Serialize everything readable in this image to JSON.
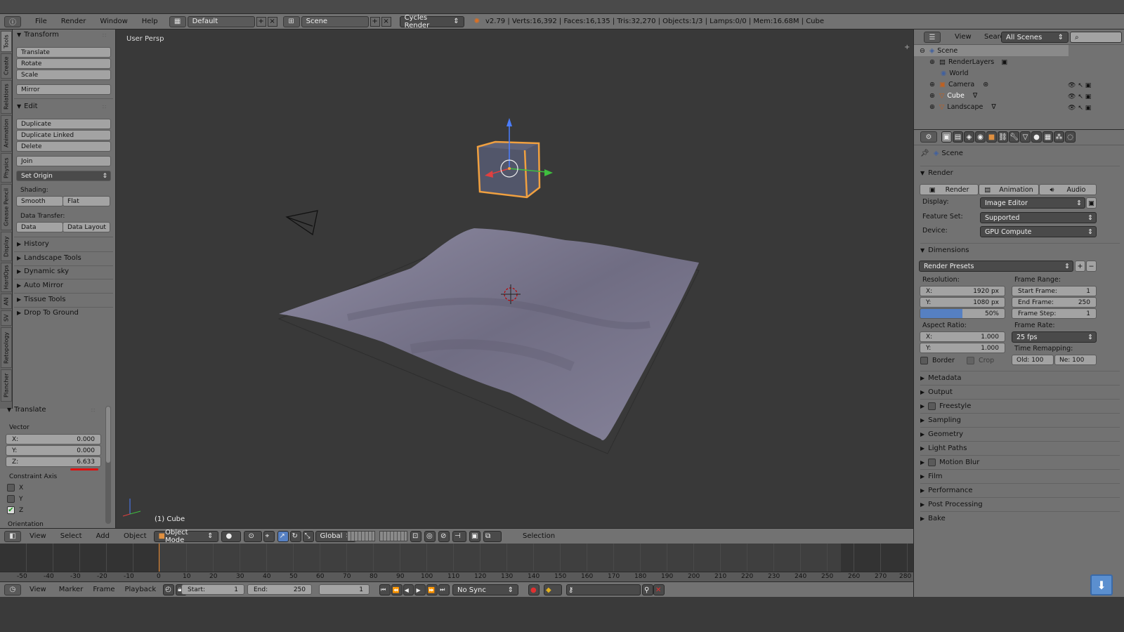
{
  "menubar": {
    "items": [
      "File",
      "Render",
      "Window",
      "Help"
    ],
    "layout": "Default",
    "scene": "Scene",
    "engine": "Cycles Render",
    "status": "v2.79 | Verts:16,392 | Faces:16,135 | Tris:32,270 | Objects:1/3 | Lamps:0/0 | Mem:16.68M | Cube"
  },
  "left_tabs": [
    "Tools",
    "Create",
    "Relations",
    "Animation",
    "Physics",
    "Grease Pencil",
    "Display",
    "HardOps",
    "AN",
    "SV",
    "Retopology",
    "Plancher"
  ],
  "tools": {
    "transform_header": "Transform",
    "transform_buttons": [
      "Translate",
      "Rotate",
      "Scale"
    ],
    "mirror": "Mirror",
    "edit_header": "Edit",
    "edit_buttons": [
      "Duplicate",
      "Duplicate Linked",
      "Delete"
    ],
    "join": "Join",
    "set_origin": "Set Origin",
    "shading_label": "Shading:",
    "smooth": "Smooth",
    "flat": "Flat",
    "data_transfer_label": "Data Transfer:",
    "data": "Data",
    "data_layout": "Data Layout",
    "collapsed": [
      "History",
      "Landscape Tools",
      "Dynamic sky",
      "Auto Mirror",
      "Tissue Tools",
      "Drop To Ground"
    ]
  },
  "operator": {
    "header": "Translate",
    "vector_label": "Vector",
    "x_label": "X:",
    "x": "0.000",
    "y_label": "Y:",
    "y": "0.000",
    "z_label": "Z:",
    "z": "6.633",
    "constraint_label": "Constraint Axis",
    "axes": [
      "X",
      "Y",
      "Z"
    ],
    "axis_checked": [
      false,
      false,
      true
    ],
    "orientation_label": "Orientation"
  },
  "viewport": {
    "persp_label": "User Persp",
    "object_label": "(1) Cube",
    "accent": "#f0a040"
  },
  "viewbar": {
    "view": "View",
    "select": "Select",
    "add": "Add",
    "object": "Object",
    "mode": "Object Mode",
    "orientation": "Global",
    "selection": "Selection"
  },
  "timeline": {
    "ticks": [
      "-50",
      "-40",
      "-30",
      "-20",
      "-10",
      "0",
      "10",
      "20",
      "30",
      "40",
      "50",
      "60",
      "70",
      "80",
      "90",
      "100",
      "110",
      "120",
      "130",
      "140",
      "150",
      "160",
      "170",
      "180",
      "190",
      "200",
      "210",
      "220",
      "230",
      "240",
      "250",
      "260",
      "270",
      "280"
    ],
    "menu": [
      "View",
      "Marker",
      "Frame",
      "Playback"
    ],
    "start_label": "Start:",
    "start": "1",
    "end_label": "End:",
    "end": "250",
    "current": "1",
    "sync": "No Sync"
  },
  "outliner": {
    "view": "View",
    "search": "Search",
    "scenes": "All Scenes",
    "items": [
      "Scene",
      "RenderLayers",
      "World",
      "Camera",
      "Cube",
      "Landscape"
    ]
  },
  "properties": {
    "context": "Scene",
    "render_header": "Render",
    "render_btn": "Render",
    "animation_btn": "Animation",
    "audio_btn": "Audio",
    "display_label": "Display:",
    "display": "Image Editor",
    "feature_label": "Feature Set:",
    "feature": "Supported",
    "device_label": "Device:",
    "device": "GPU Compute",
    "dimensions_header": "Dimensions",
    "presets": "Render Presets",
    "resolution_label": "Resolution:",
    "res_x_label": "X:",
    "res_x": "1920 px",
    "res_y_label": "Y:",
    "res_y": "1080 px",
    "res_pct": "50%",
    "frame_range_label": "Frame Range:",
    "start_frame_label": "Start Frame:",
    "start_frame": "1",
    "end_frame_label": "End Frame:",
    "end_frame": "250",
    "frame_step_label": "Frame Step:",
    "frame_step": "1",
    "aspect_label": "Aspect Ratio:",
    "asp_x_label": "X:",
    "asp_x": "1.000",
    "asp_y_label": "Y:",
    "asp_y": "1.000",
    "frame_rate_label": "Frame Rate:",
    "frame_rate": "25 fps",
    "time_remap_label": "Time Remapping:",
    "old": "Old: 100",
    "new": "Ne:  100",
    "border": "Border",
    "crop": "Crop",
    "sections": [
      "Metadata",
      "Output",
      "Freestyle",
      "Sampling",
      "Geometry",
      "Light Paths",
      "Motion Blur",
      "Film",
      "Performance",
      "Post Processing",
      "Bake"
    ]
  }
}
